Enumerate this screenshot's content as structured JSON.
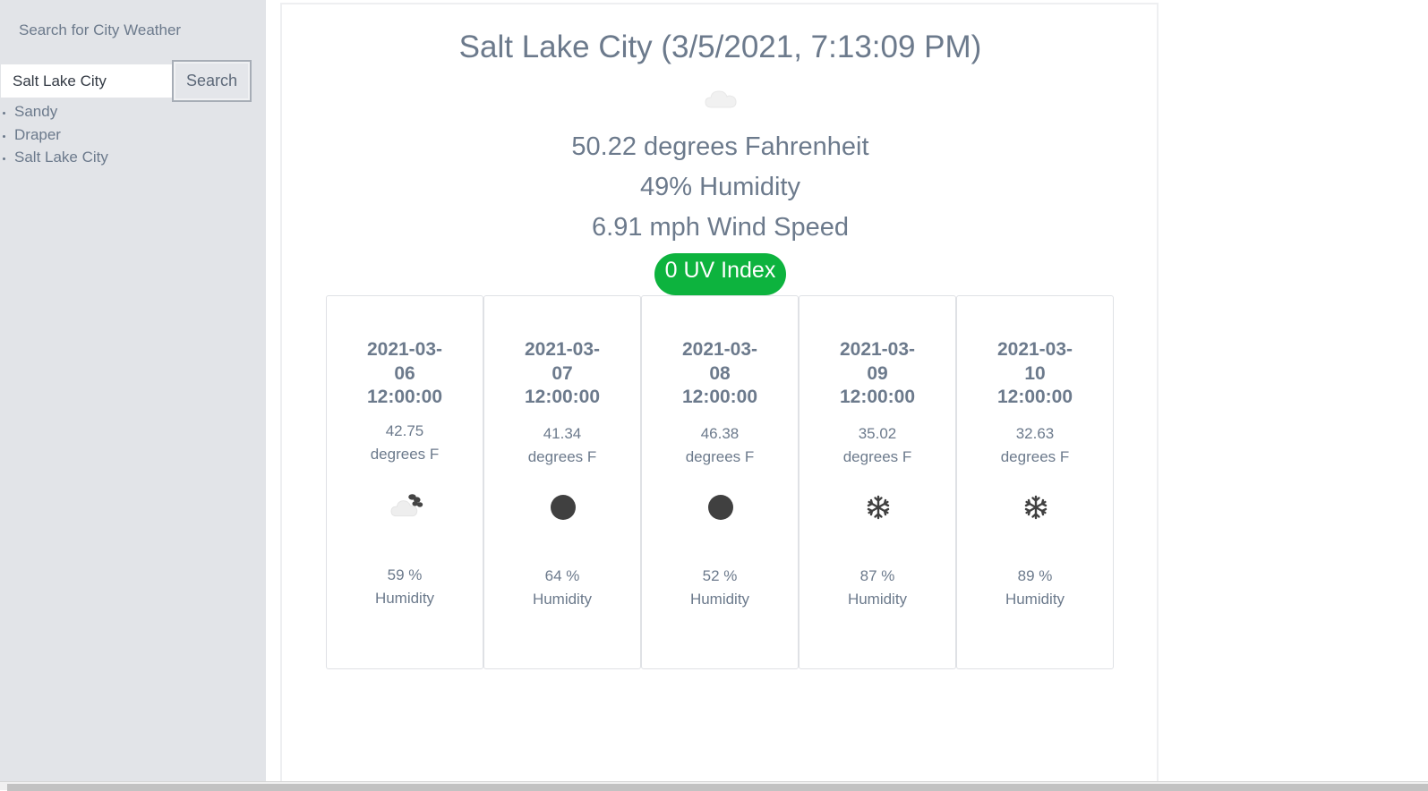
{
  "sidebar": {
    "title": "Search for City Weather",
    "search": {
      "value": "Salt Lake City",
      "placeholder": "",
      "button_label": "Search"
    },
    "history": [
      "Sandy",
      "Draper",
      "Salt Lake City"
    ]
  },
  "current": {
    "title": "Salt Lake City (3/5/2021, 7:13:09 PM)",
    "icon": "cloud-icon",
    "temperature": "50.22 degrees Fahrenheit",
    "humidity": "49% Humidity",
    "wind": "6.91 mph Wind Speed",
    "uv": "0 UV Index",
    "uv_color": "#0db33e"
  },
  "forecast": [
    {
      "date_line1": "2021-03-",
      "date_line2": "06",
      "date_line3": "12:00:00",
      "temp": "42.75",
      "temp_unit": "degrees F",
      "icon": "cloud-rain-icon",
      "humidity": "59 %",
      "humidity_label": "Humidity"
    },
    {
      "date_line1": "2021-03-",
      "date_line2": "07",
      "date_line3": "12:00:00",
      "temp": "41.34",
      "temp_unit": "degrees F",
      "icon": "clear-icon",
      "humidity": "64 %",
      "humidity_label": "Humidity"
    },
    {
      "date_line1": "2021-03-",
      "date_line2": "08",
      "date_line3": "12:00:00",
      "temp": "46.38",
      "temp_unit": "degrees F",
      "icon": "clear-icon",
      "humidity": "52 %",
      "humidity_label": "Humidity"
    },
    {
      "date_line1": "2021-03-",
      "date_line2": "09",
      "date_line3": "12:00:00",
      "temp": "35.02",
      "temp_unit": "degrees F",
      "icon": "snowflake-icon",
      "humidity": "87 %",
      "humidity_label": "Humidity"
    },
    {
      "date_line1": "2021-03-",
      "date_line2": "10",
      "date_line3": "12:00:00",
      "temp": "32.63",
      "temp_unit": "degrees F",
      "icon": "snowflake-icon",
      "humidity": "89 %",
      "humidity_label": "Humidity"
    }
  ]
}
